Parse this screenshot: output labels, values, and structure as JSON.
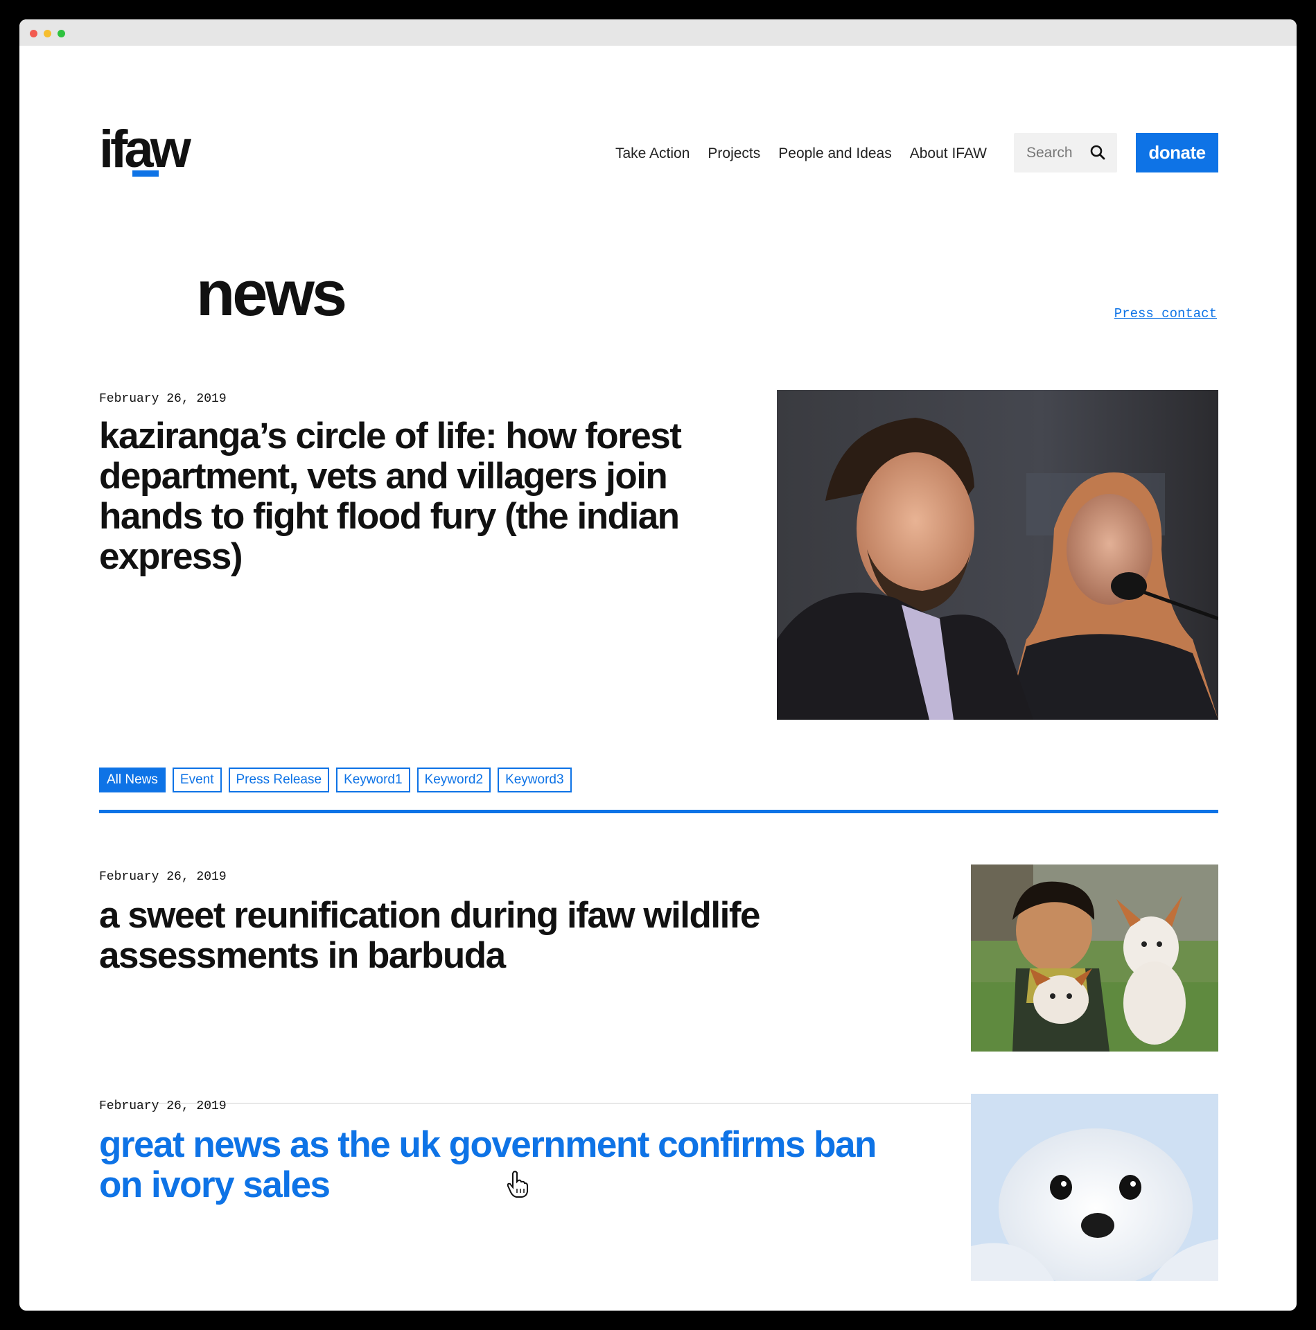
{
  "site": {
    "logo_text": "ifaw",
    "nav": [
      "Take Action",
      "Projects",
      "People and Ideas",
      "About IFAW"
    ],
    "search_placeholder": "Search",
    "donate_label": "donate"
  },
  "page": {
    "title": "news",
    "press_contact": "Press contact"
  },
  "featured": {
    "date": "February 26, 2019",
    "title": "kaziranga’s circle of life: how forest department, vets and villagers join hands to fight flood fury (the indian express)",
    "image": "man-speaking-at-microphone-photo"
  },
  "filters": [
    "All News",
    "Event",
    "Press Release",
    "Keyword1",
    "Keyword2",
    "Keyword3"
  ],
  "active_filter": "All News",
  "articles": [
    {
      "date": "February 26, 2019",
      "title": "a sweet reunification during ifaw wildlife assessments in barbuda",
      "image": "boy-with-puppies-photo"
    },
    {
      "date": "February 26, 2019",
      "title": "great news as the uk government confirms ban on ivory sales",
      "image": "seal-pup-photo"
    }
  ],
  "colors": {
    "accent": "#0e73e6",
    "text": "#111111"
  }
}
